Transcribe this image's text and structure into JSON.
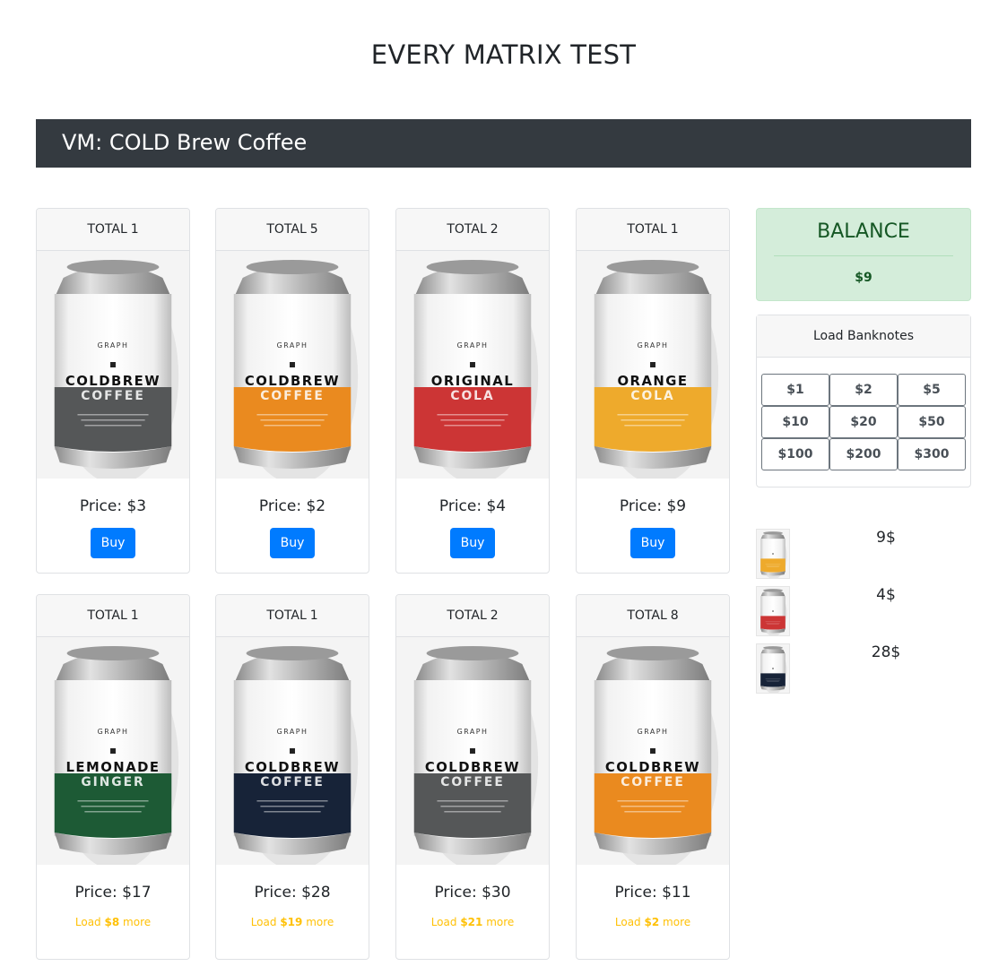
{
  "page": {
    "title": "EVERY MATRIX TEST"
  },
  "vm": {
    "header": "VM: COLD Brew Coffee"
  },
  "total_label": "TOTAL",
  "price_label": "Price:",
  "buy_label": "Buy",
  "load_prefix": "Load",
  "load_suffix": "more",
  "products": [
    {
      "total": "1",
      "price": "$3",
      "brand": "GRAPH",
      "name1": "COLDBREW",
      "name2": "COFFEE",
      "band": "#555758",
      "action": "buy"
    },
    {
      "total": "5",
      "price": "$2",
      "brand": "GRAPH",
      "name1": "COLDBREW",
      "name2": "COFFEE",
      "band": "#ea8a1f",
      "action": "buy"
    },
    {
      "total": "2",
      "price": "$4",
      "brand": "GRAPH",
      "name1": "ORIGINAL",
      "name2": "COLA",
      "band": "#cc3535",
      "action": "buy"
    },
    {
      "total": "1",
      "price": "$9",
      "brand": "GRAPH",
      "name1": "ORANGE",
      "name2": "COLA",
      "band": "#eeaa2c",
      "action": "buy"
    },
    {
      "total": "1",
      "price": "$17",
      "brand": "GRAPH",
      "name1": "LEMONADE",
      "name2": "GINGER",
      "band": "#1d5a35",
      "action": "load",
      "need": "$8"
    },
    {
      "total": "1",
      "price": "$28",
      "brand": "GRAPH",
      "name1": "COLDBREW",
      "name2": "COFFEE",
      "band": "#172338",
      "action": "load",
      "need": "$19"
    },
    {
      "total": "2",
      "price": "$30",
      "brand": "GRAPH",
      "name1": "COLDBREW",
      "name2": "COFFEE",
      "band": "#555758",
      "action": "load",
      "need": "$21"
    },
    {
      "total": "8",
      "price": "$11",
      "brand": "GRAPH",
      "name1": "COLDBREW",
      "name2": "COFFEE",
      "band": "#ea8a1f",
      "action": "load",
      "need": "$2"
    }
  ],
  "balance": {
    "title": "BALANCE",
    "value": "$9"
  },
  "banknotes": {
    "title": "Load Banknotes",
    "notes": [
      "$1",
      "$2",
      "$5",
      "$10",
      "$20",
      "$50",
      "$100",
      "$200",
      "$300"
    ]
  },
  "purchased": [
    {
      "amount": "9$",
      "band": "#eeaa2c"
    },
    {
      "amount": "4$",
      "band": "#cc3535"
    },
    {
      "amount": "28$",
      "band": "#172338"
    }
  ],
  "colors": {
    "header_bg": "#343a40",
    "primary": "#007bff",
    "warning": "#ffc107",
    "success_bg": "#d4edda",
    "success_text": "#155724"
  }
}
